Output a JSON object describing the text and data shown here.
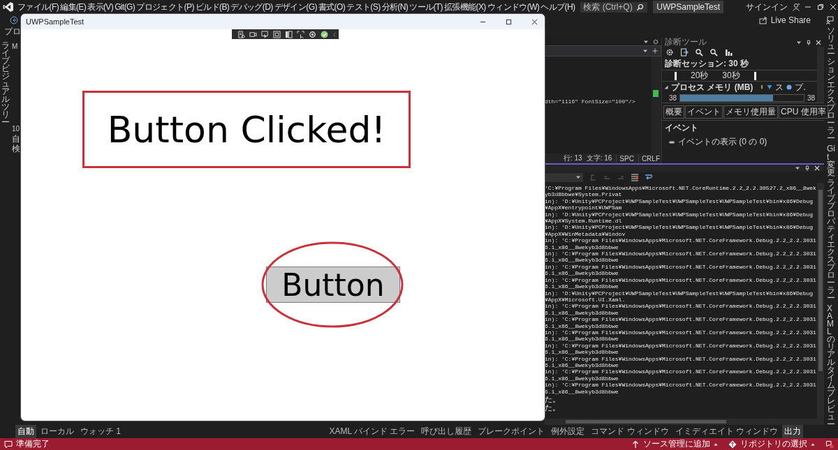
{
  "menu": [
    "ファイル(F)",
    "編集(E)",
    "表示(V)",
    "Git(G)",
    "プロジェクト(P)",
    "ビルド(B)",
    "デバッグ(D)",
    "デザイン(G)",
    "書式(O)",
    "テスト(S)",
    "分析(N)",
    "ツール(T)",
    "拡張機能(X)",
    "ウィンドウ(W)",
    "ヘルプ(H)"
  ],
  "search": {
    "placeholder": "検索 (Ctrl+Q)"
  },
  "solution_badge": "UWPSampleTest",
  "sign_in": "サインイン",
  "live_share": "Live Share",
  "debug_location": "プロ",
  "left_panel": {
    "vertical_tab": "ライブビジュアルツリー",
    "fragments": [
      "M",
      "10",
      "自",
      "検"
    ]
  },
  "editor": {
    "code_line": "dth=\"1116\" FontSize=\"100\"/>",
    "status": [
      "行: 13",
      "文字: 16",
      "SPC",
      "CRLF"
    ]
  },
  "diagnostics": {
    "title": "診断ツール",
    "session": "診断セッション: 30 秒",
    "timeline_labels": [
      "20秒",
      "30秒"
    ],
    "memory_header": "プロセス メモリ (MB)",
    "legend": [
      "ス",
      "プ."
    ],
    "memory_min": "38",
    "memory_max": "38",
    "tabs": [
      "概要",
      "イベント",
      "メモリ使用量",
      "CPU 使用率"
    ],
    "events_header": "イベント",
    "events_row": "イベントの表示 (0 の 0)"
  },
  "output": {
    "lines": [
      "'C:¥Program Files¥WindowsApps¥Microsoft.NET.CoreRuntime.2.2_2.2.30527.2_x86__8wekyb3d8bbwe¥System.Privat",
      "in): 'D:¥Unity¥PCProject¥UWPSampleTest¥UWPSampleTest¥UWPSampleTest¥bin¥x86¥Debug¥AppX¥entrypoint¥UWPSam",
      "in): 'D:¥Unity¥PCProject¥UWPSampleTest¥UWPSampleTest¥UWPSampleTest¥bin¥x86¥Debug¥AppX¥System.Runtime.dl",
      "in): 'D:¥Unity¥PCProject¥UWPSampleTest¥UWPSampleTest¥UWPSampleTest¥bin¥x86¥Debug¥AppX¥WinMetadata¥Windov",
      "in): 'C:¥Program Files¥WindowsApps¥Microsoft.NET.CoreFramework.Debug.2.2_2.2.30316.1_x86__8wekyb3d8bbwe",
      "in): 'C:¥Program Files¥WindowsApps¥Microsoft.NET.CoreFramework.Debug.2.2_2.2.30316.1_x86__8wekyb3d8bbwe",
      "in): 'C:¥Program Files¥WindowsApps¥Microsoft.NET.CoreFramework.Debug.2.2_2.2.30316.1_x86__8wekyb3d8bbwe",
      "in): 'C:¥Program Files¥WindowsApps¥Microsoft.NET.CoreFramework.Debug.2.2_2.2.30316.1_x86__8wekyb3d8bbwe",
      "in): 'D:¥Unity¥PCProject¥UWPSampleTest¥UWPSampleTest¥UWPSampleTest¥bin¥x86¥Debug¥AppX¥Microsoft.UI.Xaml.",
      "in): 'C:¥Program Files¥WindowsApps¥Microsoft.NET.CoreFramework.Debug.2.2_2.2.30316.1_x86__8wekyb3d8bbwe",
      "in): 'C:¥Program Files¥WindowsApps¥Microsoft.NET.CoreFramework.Debug.2.2_2.2.30316.1_x86__8wekyb3d8bbwe",
      "in): 'C:¥Program Files¥WindowsApps¥Microsoft.NET.CoreFramework.Debug.2.2_2.2.30316.1_x86__8wekyb3d8bbwe",
      "in): 'C:¥Program Files¥WindowsApps¥Microsoft.NET.CoreFramework.Debug.2.2_2.2.30316.1_x86__8wekyb3d8bbwe",
      "in): 'C:¥Program Files¥WindowsApps¥Microsoft.NET.CoreFramework.Debug.2.2_2.2.30316.1_x86__8wekyb3d8bbwe",
      "in): 'C:¥Program Files¥WindowsApps¥Microsoft.NET.CoreFramework.Debug.2.2_2.2.30316.1_x86__8wekyb3d8bbwe",
      "in): 'C:¥Program Files¥WindowsApps¥Microsoft.NET.CoreFramework.Debug.2.2_2.2.30316.1_x86__8wekyb3d8bbwe",
      "た。",
      "た。"
    ]
  },
  "right_tabs": [
    "ソリューションエクスプローラー",
    "Git変更",
    "ライブプロパティエクスプローラー",
    "XAMLのリアルタイムプレビュー"
  ],
  "bottom_tabs_left": [
    {
      "label": "自動",
      "selected": true
    },
    {
      "label": "ローカル",
      "selected": false
    },
    {
      "label": "ウォッチ 1",
      "selected": false
    }
  ],
  "bottom_tabs_right": [
    {
      "label": "XAML バインド エラー",
      "selected": false
    },
    {
      "label": "呼び出し履歴",
      "selected": false
    },
    {
      "label": "ブレークポイント",
      "selected": false
    },
    {
      "label": "例外設定",
      "selected": false
    },
    {
      "label": "コマンド ウィンドウ",
      "selected": false
    },
    {
      "label": "イミディエイト ウィンドウ",
      "selected": false
    },
    {
      "label": "出力",
      "selected": true
    }
  ],
  "status_bar": {
    "text": "準備完了",
    "source_control": "ソース管理に追加",
    "repository": "リポジトリの選択"
  },
  "app_window": {
    "title": "UWPSampleTest",
    "message": "Button Clicked!",
    "button": "Button"
  }
}
